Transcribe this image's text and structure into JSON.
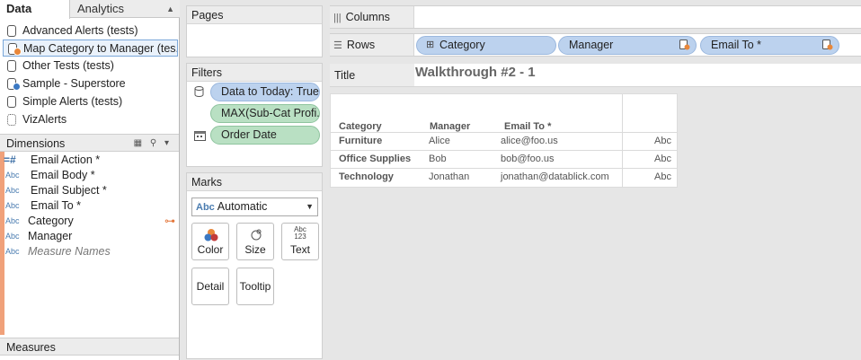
{
  "tabs": {
    "data": "Data",
    "analytics": "Analytics"
  },
  "datasources": [
    {
      "label": "Advanced Alerts (tests)"
    },
    {
      "label": "Map Category to Manager (tes..."
    },
    {
      "label": "Other Tests (tests)"
    },
    {
      "label": "Sample - Superstore"
    },
    {
      "label": "Simple Alerts (tests)"
    },
    {
      "label": "VizAlerts"
    }
  ],
  "dimensions": {
    "header": "Dimensions",
    "fields": [
      {
        "type": "#",
        "label": "Email Action *"
      },
      {
        "type": "Abc",
        "label": "Email Body *"
      },
      {
        "type": "Abc",
        "label": "Email Subject *"
      },
      {
        "type": "Abc",
        "label": "Email To *"
      },
      {
        "type": "Abc",
        "label": "Category"
      },
      {
        "type": "Abc",
        "label": "Manager"
      },
      {
        "type": "Abc",
        "label": "Measure Names"
      }
    ]
  },
  "measures": {
    "header": "Measures"
  },
  "pages": {
    "title": "Pages"
  },
  "filters": {
    "title": "Filters",
    "items": [
      {
        "label": "Data to Today: True",
        "color": "blue"
      },
      {
        "label": "MAX(Sub-Cat Profi...",
        "color": "green"
      },
      {
        "label": "Order Date",
        "color": "green"
      }
    ]
  },
  "marks": {
    "title": "Marks",
    "type_abc": "Abc",
    "type": "Automatic",
    "buttons": {
      "color": "Color",
      "size": "Size",
      "text": "Text",
      "detail": "Detail",
      "tooltip": "Tooltip"
    },
    "text_icon_top": "Abc",
    "text_icon_bottom": "123"
  },
  "columns": {
    "label": "Columns"
  },
  "rows": {
    "label": "Rows",
    "pills": [
      "Category",
      "Manager",
      "Email To *"
    ]
  },
  "title": {
    "label": "Title",
    "value": "Walkthrough #2 - 1"
  },
  "table": {
    "headers": {
      "category": "Category",
      "manager": "Manager",
      "email": "Email To *"
    },
    "rows": [
      {
        "category": "Furniture",
        "manager": "Alice",
        "email": "alice@foo.us",
        "value": "Abc"
      },
      {
        "category": "Office Supplies",
        "manager": "Bob",
        "email": "bob@foo.us",
        "value": "Abc"
      },
      {
        "category": "Technology",
        "manager": "Jonathan",
        "email": "jonathan@datablick.com",
        "value": "Abc"
      }
    ]
  },
  "colors": {
    "dimension_bar": "#f0a17a",
    "pill_blue": "#bcd2ee",
    "pill_green": "#b9e0c3",
    "badge_orange": "#e8873a",
    "badge_blue": "#3b78c2"
  }
}
